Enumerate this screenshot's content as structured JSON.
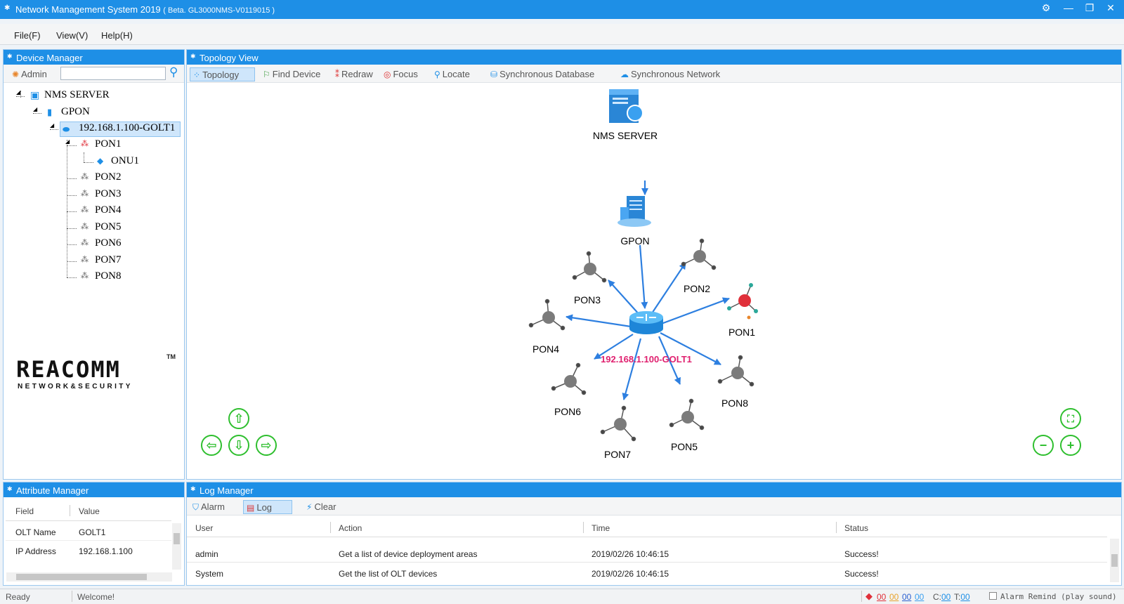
{
  "window": {
    "title": "Network Management System 2019",
    "version": "( Beta. GL3000NMS-V0119015 )",
    "settings": "⚙",
    "minimize": "—",
    "restore": "❐",
    "close": "✕"
  },
  "menu": {
    "file": "File(F)",
    "view": "View(V)",
    "help": "Help(H)"
  },
  "device_manager": {
    "title": "Device Manager",
    "user": "Admin",
    "search_value": "",
    "search_placeholder": "",
    "tree": {
      "root": "NMS SERVER",
      "gpon": "GPON",
      "olt": "192.168.1.100-GOLT1",
      "pon1": "PON1",
      "onu1": "ONU1",
      "pon2": "PON2",
      "pon3": "PON3",
      "pon4": "PON4",
      "pon5": "PON5",
      "pon6": "PON6",
      "pon7": "PON7",
      "pon8": "PON8"
    },
    "logo_text": "REACOMM",
    "logo_tm": "TM",
    "logo_sub": "NETWORK&SECURITY"
  },
  "topology": {
    "title": "Topology View",
    "toolbar": {
      "topology": "Topology",
      "find": "Find Device",
      "redraw": "Redraw",
      "focus": "Focus",
      "locate": "Locate",
      "sync_db": "Synchronous Database",
      "sync_net": "Synchronous Network"
    },
    "nodes": {
      "server": "NMS SERVER",
      "gpon": "GPON",
      "olt": "192.168.1.100-GOLT1",
      "pon1": "PON1",
      "pon2": "PON2",
      "pon3": "PON3",
      "pon4": "PON4",
      "pon5": "PON5",
      "pon6": "PON6",
      "pon7": "PON7",
      "pon8": "PON8"
    },
    "colors": {
      "link": "#2d7fe0",
      "olt_label": "#e0206f",
      "pon_active": "#e0303a",
      "pon_idle": "#7b7b7b",
      "nav": "#2fbf2f"
    },
    "nav": {
      "up": "⇧",
      "down": "⇩",
      "left": "⇦",
      "right": "⇨",
      "fit": "⛶",
      "zoom_out": "−",
      "zoom_in": "+"
    }
  },
  "attribute_manager": {
    "title": "Attribute Manager",
    "col_field": "Field",
    "col_value": "Value",
    "rows": [
      {
        "field": "OLT Name",
        "value": "GOLT1"
      },
      {
        "field": "IP Address",
        "value": "192.168.1.100"
      }
    ]
  },
  "log_manager": {
    "title": "Log Manager",
    "alarm": "Alarm",
    "log": "Log",
    "clear": "Clear",
    "columns": {
      "user": "User",
      "action": "Action",
      "time": "Time",
      "status": "Status"
    },
    "rows": [
      {
        "user": "admin",
        "action": "Get a list of device deployment areas",
        "time": "2019/02/26 10:46:15",
        "status": "Success!"
      },
      {
        "user": "System",
        "action": "Get the list of OLT devices",
        "time": "2019/02/26 10:46:15",
        "status": "Success!"
      }
    ]
  },
  "status": {
    "ready": "Ready",
    "welcome": "Welcome!",
    "a1": "00",
    "a2": "00",
    "a3": "00",
    "a4": "00",
    "c_label": "C:",
    "c_value": "00",
    "t_label": "T:",
    "t_value": "00",
    "alarm_remind": "Alarm Remind (play sound)"
  }
}
